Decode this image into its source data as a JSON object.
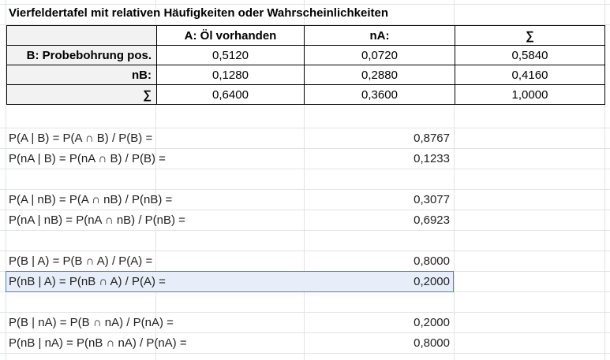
{
  "title": "Vierfeldertafel mit relativen Häufigkeiten oder Wahrscheinlichkeiten",
  "table": {
    "header": [
      "",
      "A: Öl vorhanden",
      "nA:",
      "∑"
    ],
    "rows": [
      {
        "label": "B: Probebohrung pos.",
        "values": [
          "0,5120",
          "0,0720",
          "0,5840"
        ]
      },
      {
        "label": "nB:",
        "values": [
          "0,1280",
          "0,2880",
          "0,4160"
        ]
      },
      {
        "label": "∑",
        "values": [
          "0,6400",
          "0,3600",
          "1,0000"
        ]
      }
    ]
  },
  "calculations": [
    {
      "label": "P(A | B) = P(A ∩ B) / P(B) =",
      "value": "0,8767"
    },
    {
      "label": "P(nA | B) = P(nA ∩ B) / P(B) =",
      "value": "0,1233"
    },
    {
      "label": "P(A | nB) = P(A ∩ nB) / P(nB) =",
      "value": "0,3077"
    },
    {
      "label": "P(nA | nB) = P(nA ∩ nB) / P(nB) =",
      "value": "0,6923"
    },
    {
      "label": "P(B | A) = P(B ∩ A) / P(A) =",
      "value": "0,8000"
    },
    {
      "label": "P(nB | A) = P(nB ∩ A) / P(A) =",
      "value": "0,2000"
    },
    {
      "label": "P(B | nA) = P(B ∩ nA) / P(nA) =",
      "value": "0,2000"
    },
    {
      "label": "P(nB | nA) = P(nB ∩ nA) / P(nA) =",
      "value": "0,8000"
    }
  ],
  "colors": {
    "selection_border": "#4a7ed6",
    "selection_fill": "#e8eef9",
    "gridline": "#e2e3e3"
  }
}
